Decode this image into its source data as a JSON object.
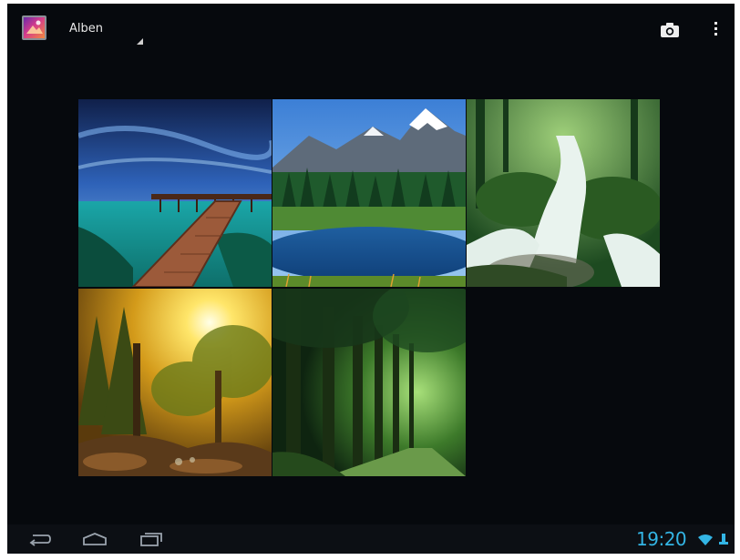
{
  "actionbar": {
    "app_icon": "gallery-app-icon",
    "spinner_label": "Alben",
    "camera_icon": "camera-icon",
    "overflow_icon": "overflow-menu-icon"
  },
  "albums": [
    {
      "scene": "ocean-pier-sunset"
    },
    {
      "scene": "mountain-lake"
    },
    {
      "scene": "forest-waterfall"
    },
    {
      "scene": "sunlit-autumn-forest"
    },
    {
      "scene": "green-tree-alley"
    }
  ],
  "navbar": {
    "back_icon": "back-icon",
    "home_icon": "home-icon",
    "recents_icon": "recent-apps-icon",
    "clock": "19:20",
    "wifi_icon": "wifi-icon",
    "usb_icon": "usb-debug-icon"
  },
  "colors": {
    "background": "#06090d",
    "clock": "#33b5e5",
    "navbar": "#0c0f14"
  }
}
